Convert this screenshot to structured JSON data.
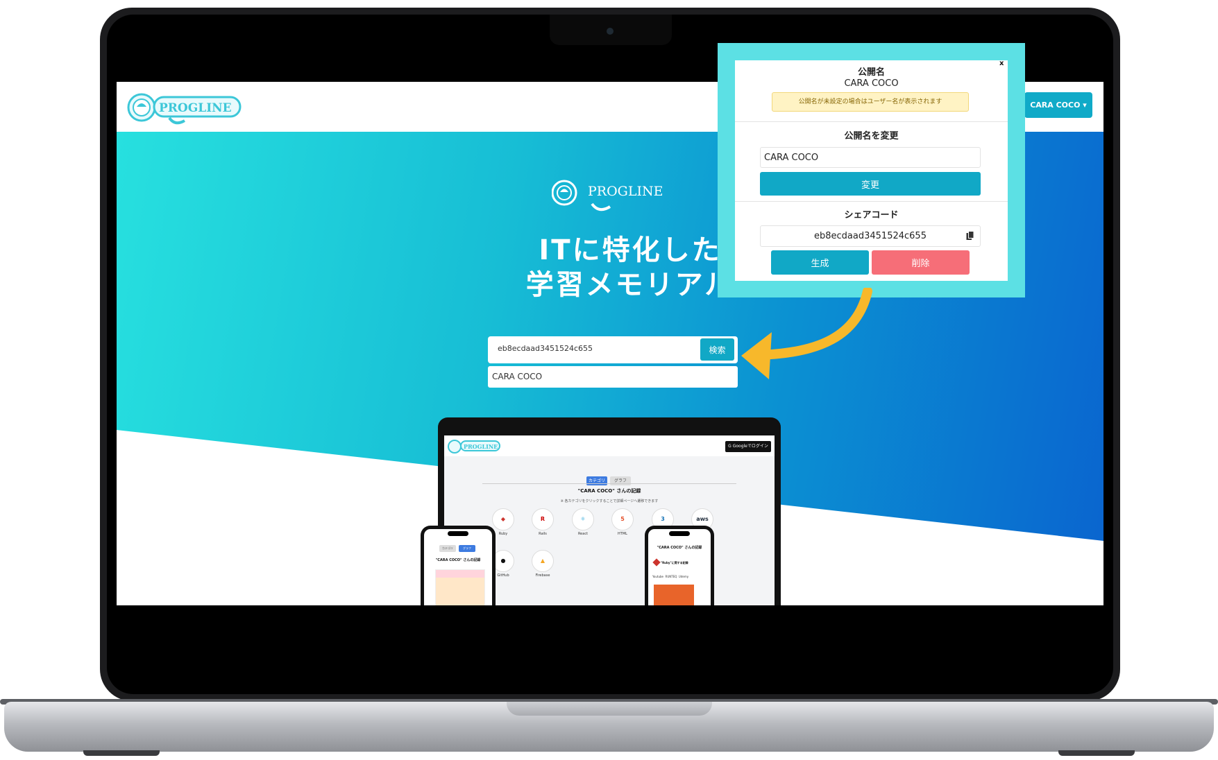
{
  "colors": {
    "accent": "#11a8c6",
    "danger": "#f66e78",
    "callout": "#5ce0e4",
    "warning_bg": "#fff3c4",
    "arrow": "#f7b82b"
  },
  "navbar": {
    "logo_text": "PROGLINE",
    "user_menu_label": "CARA COCO ▾"
  },
  "hero": {
    "logo_text": "PROGLINE",
    "headline_line1": "ITに特化した",
    "headline_line2": "学習メモリアル",
    "search": {
      "value": "eb8ecdaad3451524c655",
      "button_label": "検索"
    },
    "result": "CARA COCO"
  },
  "mockup": {
    "laptop": {
      "logo_text": "PROGLINE",
      "login_button": "G Googleでログイン",
      "tabs": [
        "カテゴリ",
        "グラフ"
      ],
      "title": "\"CARA COCO\" さんの記録",
      "note": "※ 各カテゴリをクリックすることで詳細ページへ遷移できます",
      "categories": [
        {
          "icon": "ruby-icon",
          "glyph": "◆",
          "label": "Ruby",
          "color": "#cc342d"
        },
        {
          "icon": "rails-icon",
          "glyph": "R",
          "label": "Rails",
          "color": "#c00"
        },
        {
          "icon": "react-icon",
          "glyph": "⚛",
          "label": "React",
          "color": "#27a6d9"
        },
        {
          "icon": "html-icon",
          "glyph": "5",
          "label": "HTML",
          "color": "#e44d26"
        },
        {
          "icon": "css-icon",
          "glyph": "3",
          "label": "CSS",
          "color": "#1572b6"
        },
        {
          "icon": "aws-icon",
          "glyph": "aws",
          "label": "AWS",
          "color": "#232f3e"
        },
        {
          "icon": "github-icon",
          "glyph": "●",
          "label": "GitHub",
          "color": "#111"
        },
        {
          "icon": "firebase-icon",
          "glyph": "▲",
          "label": "Firebase",
          "color": "#f5a623"
        }
      ]
    },
    "phone_left": {
      "tabs": [
        "カテゴリ",
        "グラフ"
      ],
      "title": "\"CARA COCO\" さんの記録"
    },
    "phone_right": {
      "title": "\"CARA COCO\" さんの記録",
      "subtitle": "\"Ruby\"に関する記録",
      "tags": [
        "Youtube",
        "RUNTEQ",
        "Udemy"
      ]
    }
  },
  "modal": {
    "close_label": "x",
    "public_name_heading": "公開名",
    "public_name_value": "CARA COCO",
    "warning": "公開名が未設定の場合はユーザー名が表示されます",
    "change_heading": "公開名を変更",
    "change_input_value": "CARA COCO",
    "change_button": "変更",
    "share_heading": "シェアコード",
    "share_code": "eb8ecdaad3451524c655",
    "generate_button": "生成",
    "delete_button": "削除"
  }
}
